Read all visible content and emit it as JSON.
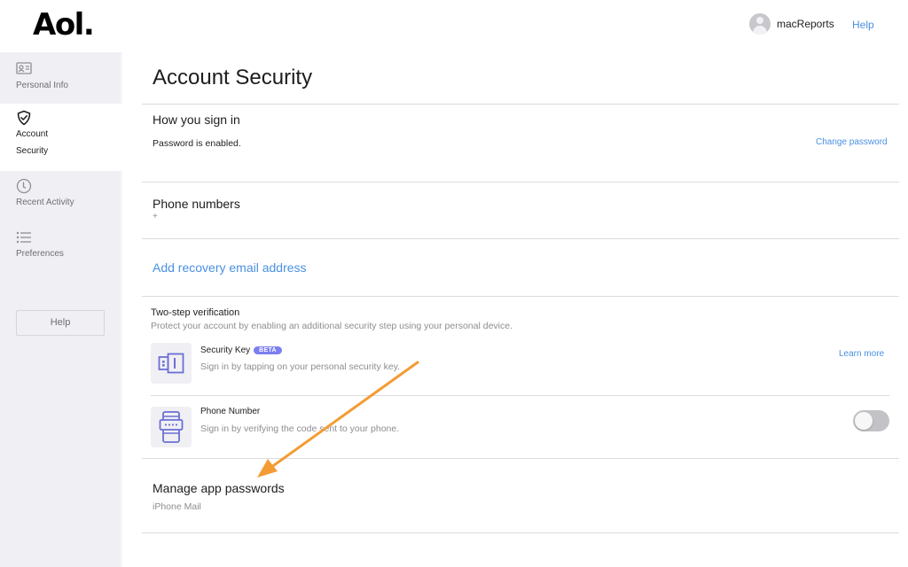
{
  "header": {
    "logo": "Aol.",
    "username": "macReports",
    "help": "Help"
  },
  "sidebar": {
    "items": [
      {
        "label": "Personal Info",
        "icon": "id-card-icon",
        "active": false
      },
      {
        "label_line1": "Account",
        "label_line2": "Security",
        "icon": "shield-check-icon",
        "active": true
      },
      {
        "label": "Recent Activity",
        "icon": "clock-icon",
        "active": false
      },
      {
        "label": "Preferences",
        "icon": "list-icon",
        "active": false
      }
    ],
    "help_button": "Help"
  },
  "main": {
    "title": "Account Security",
    "sign_in": {
      "title": "How you sign in",
      "status": "Password is enabled.",
      "action": "Change password"
    },
    "phone_numbers": {
      "title": "Phone numbers",
      "value": "+"
    },
    "recovery_email": {
      "action": "Add recovery email address"
    },
    "two_step": {
      "title": "Two-step verification",
      "description": "Protect your account by enabling an additional security step using your personal device.",
      "methods": [
        {
          "title": "Security Key",
          "badge": "BETA",
          "description": "Sign in by tapping on your personal security key.",
          "action": "Learn more",
          "icon": "security-key-icon"
        },
        {
          "title": "Phone Number",
          "description": "Sign in by verifying the code sent to your phone.",
          "toggle_on": false,
          "icon": "phone-code-icon"
        }
      ]
    },
    "app_passwords": {
      "title": "Manage app passwords",
      "items": [
        "iPhone Mail"
      ]
    }
  },
  "annotation": {
    "arrow_color": "#f39c34"
  },
  "colors": {
    "link": "#4a90e2",
    "sidebar_bg": "#f0f0f4",
    "badge": "#7b7ff0",
    "icon_accent": "#6b6fd4"
  }
}
